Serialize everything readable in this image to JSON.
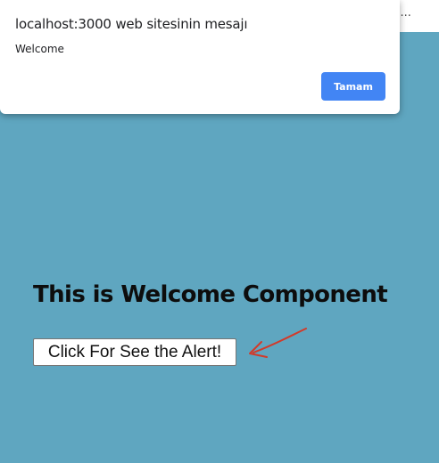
{
  "browser": {
    "tab_fragment": "y -..."
  },
  "dialog": {
    "title": "localhost:3000 web sitesinin mesajı",
    "message": "Welcome",
    "ok_label": "Tamam"
  },
  "page": {
    "heading": "This is Welcome Component",
    "button_label": "Click For See the Alert!"
  },
  "colors": {
    "page_background": "#5fa6c0",
    "dialog_button": "#4285f4",
    "arrow": "#d23a2a"
  },
  "icons": {
    "annotation": "arrow-icon"
  }
}
